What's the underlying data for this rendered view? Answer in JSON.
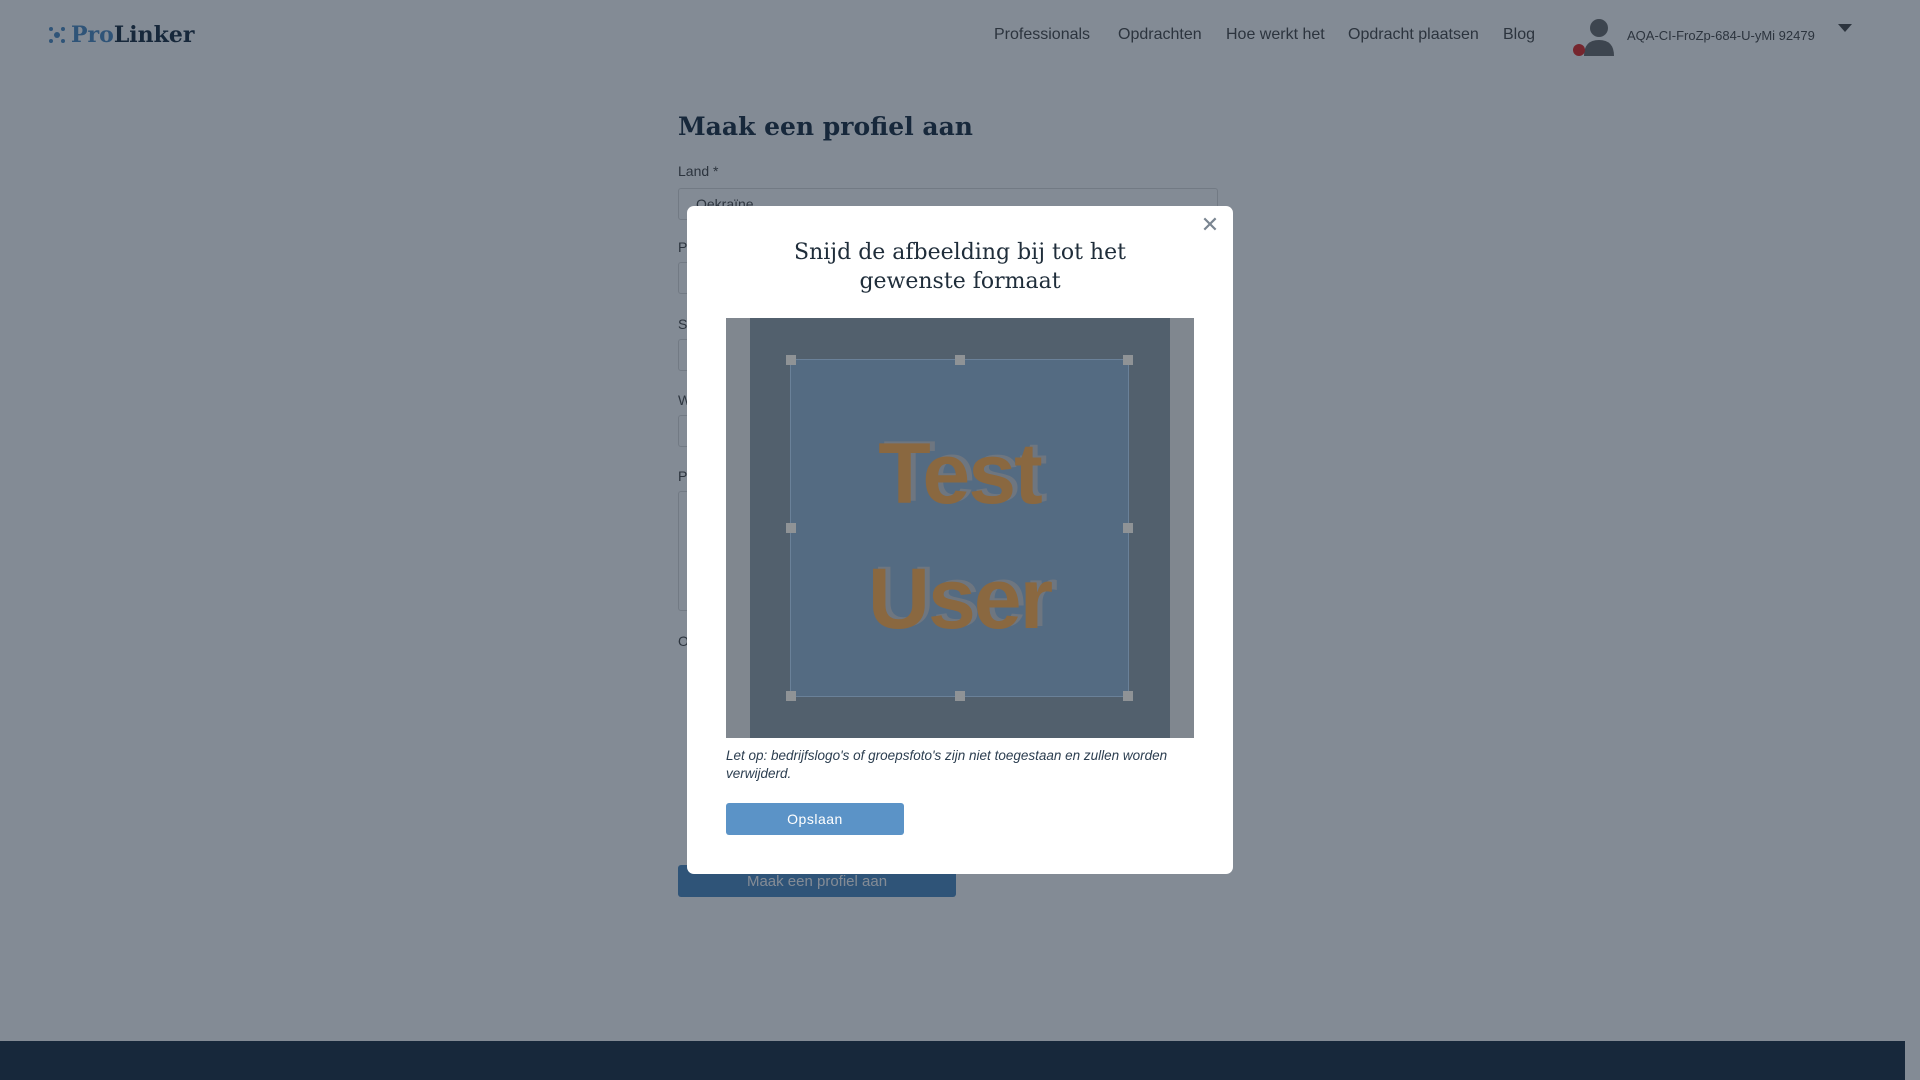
{
  "header": {
    "logo": {
      "part1": "Pro",
      "part2": "Linker"
    },
    "nav": [
      "Professionals",
      "Opdrachten",
      "Hoe werkt het",
      "Opdracht plaatsen",
      "Blog"
    ],
    "username": "AQA-CI-FroZp-684-U-yMi 92479"
  },
  "form": {
    "title": "Maak een profiel aan",
    "land_label": "Land *",
    "land_value": "Oekraïne",
    "partial_labels": [
      "P",
      "S",
      "W",
      "P",
      "O"
    ],
    "submit": "Maak een profiel aan"
  },
  "modal": {
    "title_line1": "Snijd de afbeelding bij tot het",
    "title_line2": "gewenste formaat",
    "image_text_line1": "Test",
    "image_text_line2": "User",
    "note": "Let op: bedrijfslogo's of groepsfoto's zijn niet toegestaan en zullen worden verwijderd.",
    "save": "Opslaan",
    "close_icon": "close-icon"
  },
  "colors": {
    "accent": "#5b93c7",
    "overlay": "rgba(2,18,38,0.49)"
  }
}
